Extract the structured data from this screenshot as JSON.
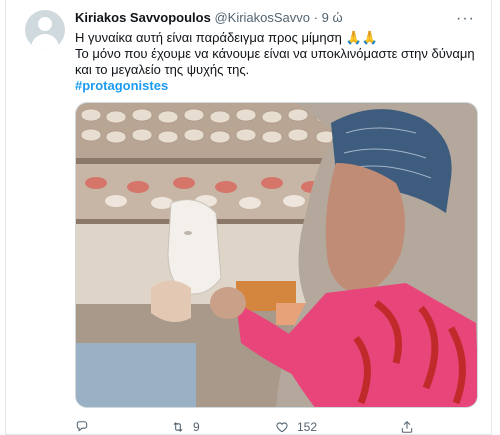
{
  "tweet": {
    "author_name": "Kiriakos Savvopoulos",
    "author_handle": "@KiriakosSavvo",
    "dot": "·",
    "time": "9 ώ",
    "more": "···",
    "text_line1": "Η γυναίκα αυτή είναι παράδειγμα προς μίμηση 🙏🙏",
    "text_line2": "Το μόνο που έχουμε να κάνουμε είναι να υποκλινόμαστε στην δύναμη και το μεγαλείο της ψυχής της.",
    "hashtag": "#protagonistes"
  },
  "actions": {
    "reply_count": "",
    "retweet_count": "9",
    "like_count": "152",
    "share_count": ""
  },
  "icons": {
    "avatar": "default-avatar-icon",
    "more": "more-dots-icon",
    "reply": "reply-bubble-icon",
    "retweet": "retweet-icon",
    "like": "heart-icon",
    "share": "share-icon"
  },
  "colors": {
    "accent": "#1d9bf0",
    "secondary_text": "#536471"
  }
}
